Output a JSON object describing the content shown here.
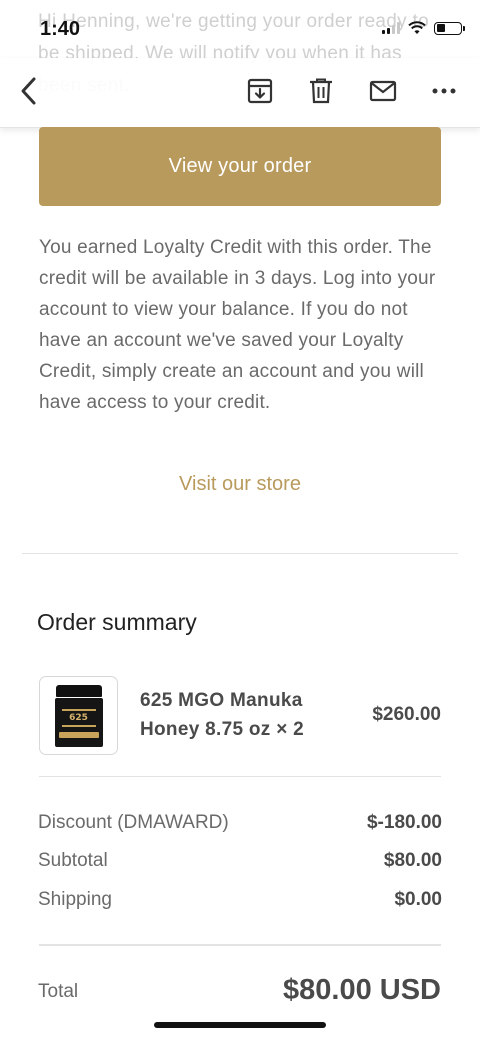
{
  "background_text": "Hi Henning, we're getting your order ready to be shipped. We will notify you when it has been sent.",
  "status_bar": {
    "time": "1:40"
  },
  "toolbar": {
    "back_icon": "chevron-left-icon",
    "archive_icon": "archive-icon",
    "trash_icon": "trash-icon",
    "mail_icon": "mail-icon",
    "more_icon": "more-horizontal-icon"
  },
  "email": {
    "cta_label": "View your order",
    "loyalty_text": "You earned Loyalty Credit with this order. The credit will be available in 3 days. Log into your account to view your balance. If you do not have an account we've saved your Loyalty Credit, simply create an account and you will have access to your credit.",
    "visit_store_label": "Visit our store",
    "order_summary": {
      "title": "Order summary",
      "product": {
        "name": "625 MGO Manuka Honey 8.75 oz × 2",
        "price": "$260.00",
        "thumb_label": "625"
      },
      "discount_label": "Discount (DMAWARD)",
      "discount_value": "$-180.00",
      "subtotal_label": "Subtotal",
      "subtotal_value": "$80.00",
      "shipping_label": "Shipping",
      "shipping_value": "$0.00",
      "total_label": "Total",
      "total_value": "$80.00 USD"
    }
  },
  "colors": {
    "accent": "#b99a5d",
    "text_muted": "#6a6a6a",
    "text_dark": "#4a4a4a"
  }
}
